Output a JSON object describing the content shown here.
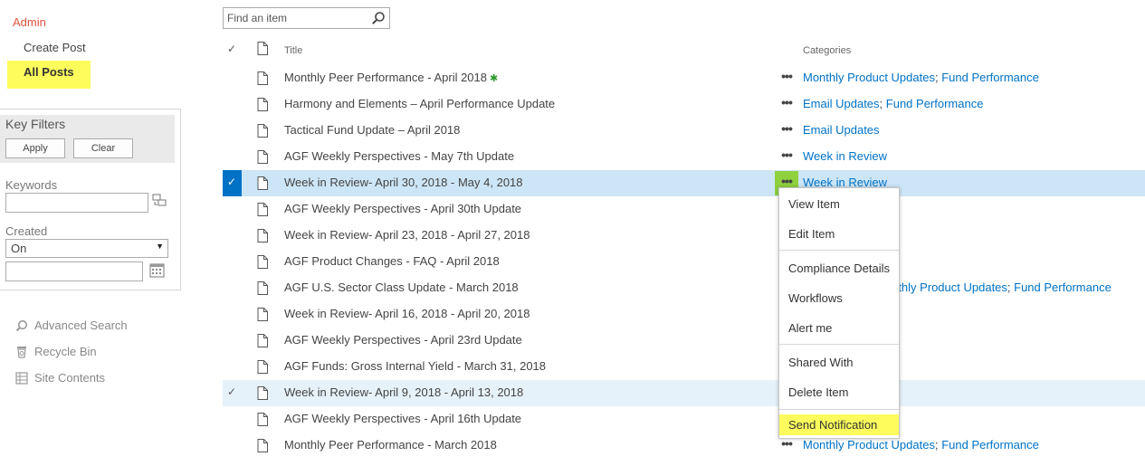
{
  "nav": {
    "admin": "Admin",
    "create_post": "Create Post",
    "all_posts": "All Posts",
    "highlight_color": "#fcfc5c",
    "accent_color": "#e0533e"
  },
  "key_filters": {
    "title": "Key Filters",
    "apply": "Apply",
    "clear": "Clear",
    "keywords_label": "Keywords",
    "keywords_value": "",
    "created_label": "Created",
    "created_operator": "On",
    "created_date_value": ""
  },
  "bottom_nav": {
    "advanced_search": "Advanced Search",
    "recycle_bin": "Recycle Bin",
    "site_contents": "Site Contents"
  },
  "search": {
    "placeholder": "Find an item",
    "value": ""
  },
  "columns": {
    "check": "✓",
    "title": "Title",
    "categories": "Categories"
  },
  "rows": [
    {
      "title": "Monthly Peer Performance - April 2018",
      "new_marker": "✱",
      "categories": [
        "Monthly Product Updates",
        "Fund Performance"
      ]
    },
    {
      "title": "Harmony and Elements – April Performance Update",
      "categories": [
        "Email Updates",
        "Fund Performance"
      ]
    },
    {
      "title": "Tactical Fund Update – April 2018",
      "categories": [
        "Email Updates"
      ]
    },
    {
      "title": "AGF Weekly Perspectives - May 7th Update",
      "categories": [
        "Week in Review"
      ]
    },
    {
      "title": "Week in Review- April 30, 2018 - May 4, 2018",
      "categories": [
        "Week in Review"
      ],
      "state": "selected"
    },
    {
      "title": "AGF Weekly Perspectives - April 30th Update",
      "categories": []
    },
    {
      "title": "Week in Review- April 23, 2018 - April 27, 2018",
      "categories": []
    },
    {
      "title": "AGF Product Changes - FAQ - April 2018",
      "categories": []
    },
    {
      "title": "AGF U.S. Sector Class Update - March 2018",
      "categories": [
        "nthly Product Updates",
        "Fund Performance"
      ]
    },
    {
      "title": "Week in Review- April 16, 2018 - April 20, 2018",
      "categories": []
    },
    {
      "title": "AGF Weekly Perspectives - April 23rd Update",
      "categories": []
    },
    {
      "title": "AGF Funds: Gross Internal Yield - March 31, 2018",
      "categories": []
    },
    {
      "title": "Week in Review- April 9, 2018 - April 13, 2018",
      "categories": [],
      "state": "hover"
    },
    {
      "title": "AGF Weekly Perspectives - April 16th Update",
      "categories": []
    },
    {
      "title": "Monthly Peer Performance - March 2018",
      "categories": [
        "Monthly Product Updates",
        "Fund Performance"
      ]
    }
  ],
  "ellipsis": "•••",
  "context_menu": {
    "view_item": "View Item",
    "edit_item": "Edit Item",
    "compliance_details": "Compliance Details",
    "workflows": "Workflows",
    "alert_me": "Alert me",
    "shared_with": "Shared With",
    "delete_item": "Delete Item",
    "send_notification": "Send Notification"
  },
  "colors": {
    "selected_row": "#cde6f7",
    "hover_row": "#e6f2fa",
    "link": "#0072c6",
    "ellipsis_highlight": "#8fd13f"
  }
}
